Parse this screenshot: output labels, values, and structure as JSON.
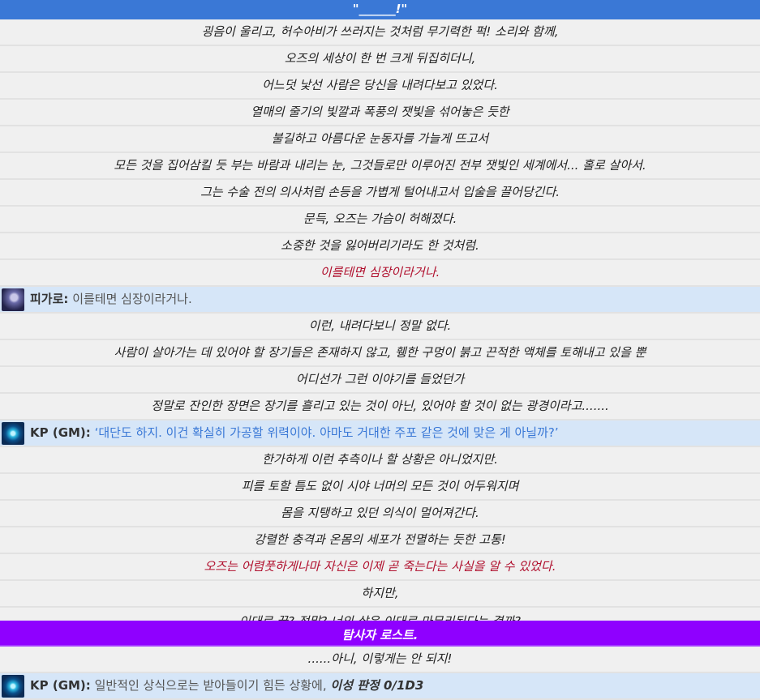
{
  "header": "\"______!\"",
  "lines": [
    {
      "type": "narr",
      "text": "굉음이 울리고, 허수아비가 쓰러지는 것처럼 무기력한 퍽! 소리와 함께,"
    },
    {
      "type": "narr",
      "text": "오즈의 세상이 한 번 크게 뒤집히더니,"
    },
    {
      "type": "narr",
      "text": "어느덧 낯선 사람은 당신을 내려다보고 있었다."
    },
    {
      "type": "narr",
      "text": "열매의 줄기의 빛깔과 폭풍의 잿빛을 섞어놓은 듯한"
    },
    {
      "type": "narr",
      "text": "불길하고 아름다운 눈동자를 가늘게 뜨고서"
    },
    {
      "type": "narr",
      "text": "모든 것을 집어삼킬 듯 부는 바람과 내리는 눈, 그것들로만 이루어진 전부 잿빛인 세계에서... 홀로 살아서."
    },
    {
      "type": "narr",
      "text": "그는 수술 전의 의사처럼 손등을 가볍게 털어내고서 입술을 끌어당긴다."
    },
    {
      "type": "narr",
      "text": "문득, 오즈는 가슴이 허해졌다."
    },
    {
      "type": "narr",
      "text": "소중한 것을 잃어버리기라도 한 것처럼."
    },
    {
      "type": "narr-red",
      "text": "이를테면 심장이라거나."
    },
    {
      "type": "chat",
      "avatar": "figaro-avatar",
      "name": "피가로:",
      "text": "이를테면 심장이라거나."
    },
    {
      "type": "narr",
      "text": "이런, 내려다보니 정말 없다."
    },
    {
      "type": "narr",
      "text": "사람이 살아가는 데 있어야 할 장기들은 존재하지 않고, 휑한 구멍이 붉고 끈적한 액체를 토해내고 있을 뿐"
    },
    {
      "type": "narr",
      "text": "어디선가 그런 이야기를 들었던가"
    },
    {
      "type": "narr",
      "text": "정말로 잔인한 장면은 장기를 흘리고 있는 것이 아닌, 있어야 할 것이 없는 광경이라고......."
    },
    {
      "type": "chat-quote",
      "avatar": "kp-avatar",
      "name": "KP (GM):",
      "text": "‘대단도 하지. 이건 확실히 가공할 위력이야. 아마도 거대한 주포 같은 것에 맞은 게 아닐까?’"
    },
    {
      "type": "narr",
      "text": "한가하게 이런 추측이나 할 상황은 아니었지만."
    },
    {
      "type": "narr",
      "text": "피를 토할 틈도 없이 시야 너머의 모든 것이 어두워지며"
    },
    {
      "type": "narr",
      "text": "몸을 지탱하고 있던 의식이 멀어져간다."
    },
    {
      "type": "narr",
      "text": "강렬한 충격과 온몸의 세포가 전멸하는 듯한 고통!"
    },
    {
      "type": "narr-red",
      "text": "오즈는 어렴풋하게나마 자신은 이제 곧 죽는다는 사실을 알 수 있었다."
    },
    {
      "type": "narr",
      "text": "하지만,"
    }
  ],
  "cut_line": "이대로 끝? 정말? 너의 삶은 이대로 마무리된다는 결까?",
  "banner": "탐사자 로스트.",
  "after": {
    "text": "......아니, 이렇게는 안 되지!"
  },
  "last_chat": {
    "name": "KP (GM):",
    "text": "일반적인 상식으로는 받아들이기 힘든 상황에,",
    "em": "이성 판정 0/1D3"
  }
}
